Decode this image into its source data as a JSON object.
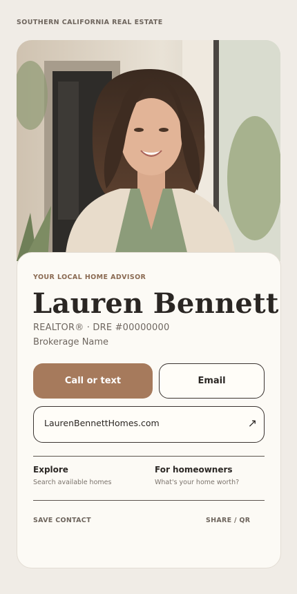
{
  "header": {
    "label": "SOUTHERN CALIFORNIA REAL ESTATE"
  },
  "profile": {
    "photo_alt": "agent-portrait",
    "eyebrow": "YOUR LOCAL HOME ADVISOR",
    "name": "Lauren Bennett",
    "license": "REALTOR® · DRE #00000000",
    "brokerage": "Brokerage Name"
  },
  "actions": {
    "call_label": "Call or text",
    "email_label": "Email",
    "website": "LaurenBennettHomes.com",
    "website_icon": "external-arrow-icon"
  },
  "links": [
    {
      "title": "Explore",
      "subtitle": "Search available homes"
    },
    {
      "title": "For homeowners",
      "subtitle": "What's your home worth?"
    }
  ],
  "footer": {
    "save_contact": "SAVE CONTACT",
    "share": "SHARE / QR"
  },
  "colors": {
    "background": "#f0ece6",
    "card": "#fcfaf5",
    "accent": "#a67a5c",
    "eyebrow": "#8a6a52"
  }
}
